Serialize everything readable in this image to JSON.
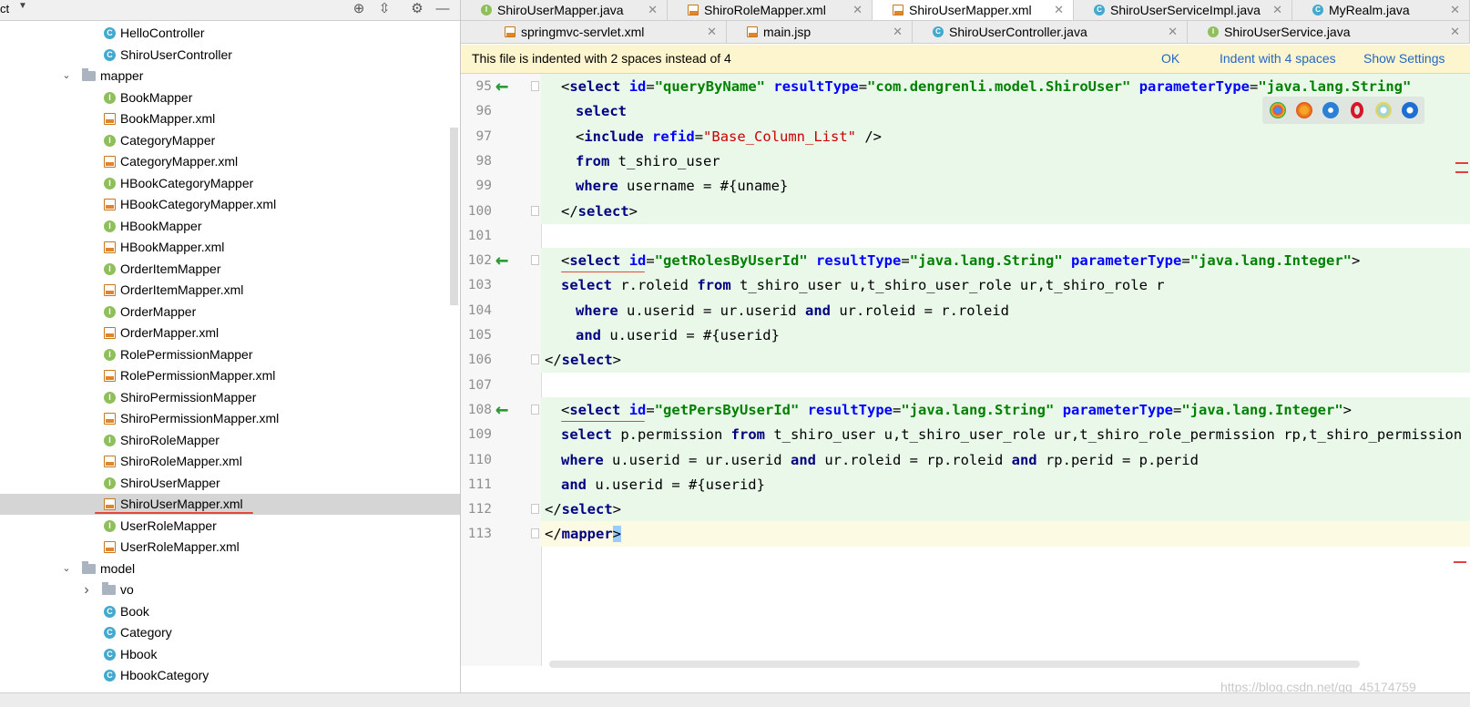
{
  "project": {
    "title": "ct",
    "tree": [
      {
        "label": "HelloController",
        "icon": "class",
        "indent": 1
      },
      {
        "label": "ShiroUserController",
        "icon": "class",
        "indent": 1
      },
      {
        "label": "mapper",
        "icon": "folder",
        "indent": 0,
        "expanded": true
      },
      {
        "label": "BookMapper",
        "icon": "interface",
        "indent": 1
      },
      {
        "label": "BookMapper.xml",
        "icon": "xml",
        "indent": 1
      },
      {
        "label": "CategoryMapper",
        "icon": "interface",
        "indent": 1
      },
      {
        "label": "CategoryMapper.xml",
        "icon": "xml",
        "indent": 1
      },
      {
        "label": "HBookCategoryMapper",
        "icon": "interface",
        "indent": 1
      },
      {
        "label": "HBookCategoryMapper.xml",
        "icon": "xml",
        "indent": 1
      },
      {
        "label": "HBookMapper",
        "icon": "interface",
        "indent": 1
      },
      {
        "label": "HBookMapper.xml",
        "icon": "xml",
        "indent": 1
      },
      {
        "label": "OrderItemMapper",
        "icon": "interface",
        "indent": 1
      },
      {
        "label": "OrderItemMapper.xml",
        "icon": "xml",
        "indent": 1
      },
      {
        "label": "OrderMapper",
        "icon": "interface",
        "indent": 1
      },
      {
        "label": "OrderMapper.xml",
        "icon": "xml",
        "indent": 1
      },
      {
        "label": "RolePermissionMapper",
        "icon": "interface",
        "indent": 1
      },
      {
        "label": "RolePermissionMapper.xml",
        "icon": "xml",
        "indent": 1
      },
      {
        "label": "ShiroPermissionMapper",
        "icon": "interface",
        "indent": 1
      },
      {
        "label": "ShiroPermissionMapper.xml",
        "icon": "xml",
        "indent": 1
      },
      {
        "label": "ShiroRoleMapper",
        "icon": "interface",
        "indent": 1
      },
      {
        "label": "ShiroRoleMapper.xml",
        "icon": "xml",
        "indent": 1
      },
      {
        "label": "ShiroUserMapper",
        "icon": "interface",
        "indent": 1
      },
      {
        "label": "ShiroUserMapper.xml",
        "icon": "xml",
        "indent": 1,
        "selected": true
      },
      {
        "label": "UserRoleMapper",
        "icon": "interface",
        "indent": 1
      },
      {
        "label": "UserRoleMapper.xml",
        "icon": "xml",
        "indent": 1
      },
      {
        "label": "model",
        "icon": "folder",
        "indent": 0,
        "expanded": true
      },
      {
        "label": "vo",
        "icon": "folder",
        "indent": 1,
        "expanded": false
      },
      {
        "label": "Book",
        "icon": "class",
        "indent": 1
      },
      {
        "label": "Category",
        "icon": "class",
        "indent": 1
      },
      {
        "label": "Hbook",
        "icon": "class",
        "indent": 1
      },
      {
        "label": "HbookCategory",
        "icon": "class",
        "indent": 1
      }
    ]
  },
  "tabs_row1": [
    {
      "label": "ShiroUserMapper.java",
      "icon": "interface"
    },
    {
      "label": "ShiroRoleMapper.xml",
      "icon": "xml"
    },
    {
      "label": "ShiroUserMapper.xml",
      "icon": "xml",
      "active": true
    },
    {
      "label": "ShiroUserServiceImpl.java",
      "icon": "class"
    },
    {
      "label": "MyRealm.java",
      "icon": "class"
    }
  ],
  "tabs_row2": [
    {
      "label": "springmvc-servlet.xml",
      "icon": "xml"
    },
    {
      "label": "main.jsp",
      "icon": "jsp"
    },
    {
      "label": "ShiroUserController.java",
      "icon": "class"
    },
    {
      "label": "ShiroUserService.java",
      "icon": "interface"
    }
  ],
  "notification": {
    "text": "This file is indented with 2 spaces instead of 4",
    "ok": "OK",
    "indent": "Indent with 4 spaces",
    "settings": "Show Settings"
  },
  "code_lines": [
    {
      "n": "95",
      "text": "<select id=\"queryByName\" resultType=\"com.dengrenli.model.ShiroUser\" parameterType=\"java.lang.String\""
    },
    {
      "n": "96",
      "text": "select"
    },
    {
      "n": "97",
      "text": "<include refid=\"Base_Column_List\" />"
    },
    {
      "n": "98",
      "text": "from t_shiro_user"
    },
    {
      "n": "99",
      "text": "where username = #{uname}"
    },
    {
      "n": "100",
      "text": "</select>"
    },
    {
      "n": "101",
      "text": ""
    },
    {
      "n": "102",
      "text": "<select id=\"getRolesByUserId\" resultType=\"java.lang.String\" parameterType=\"java.lang.Integer\">"
    },
    {
      "n": "103",
      "text": "select r.roleid from t_shiro_user u,t_shiro_user_role ur,t_shiro_role r"
    },
    {
      "n": "104",
      "text": "where u.userid = ur.userid and ur.roleid = r.roleid"
    },
    {
      "n": "105",
      "text": "and u.userid = #{userid}"
    },
    {
      "n": "106",
      "text": "</select>"
    },
    {
      "n": "107",
      "text": ""
    },
    {
      "n": "108",
      "text": "<select id=\"getPersByUserId\" resultType=\"java.lang.String\" parameterType=\"java.lang.Integer\">"
    },
    {
      "n": "109",
      "text": "select p.permission from t_shiro_user u,t_shiro_user_role ur,t_shiro_role_permission rp,t_shiro_permission p"
    },
    {
      "n": "110",
      "text": "where u.userid = ur.userid and ur.roleid = rp.roleid and rp.perid = p.perid"
    },
    {
      "n": "111",
      "text": "and u.userid = #{userid}"
    },
    {
      "n": "112",
      "text": "</select>"
    },
    {
      "n": "113",
      "text": "</mapper>"
    }
  ],
  "watermark": "https://blog.csdn.net/qq_45174759",
  "colors": {
    "accent": "#2467c7",
    "changed_bg": "#eaf8ea",
    "arrow": "#2d9a3a"
  }
}
